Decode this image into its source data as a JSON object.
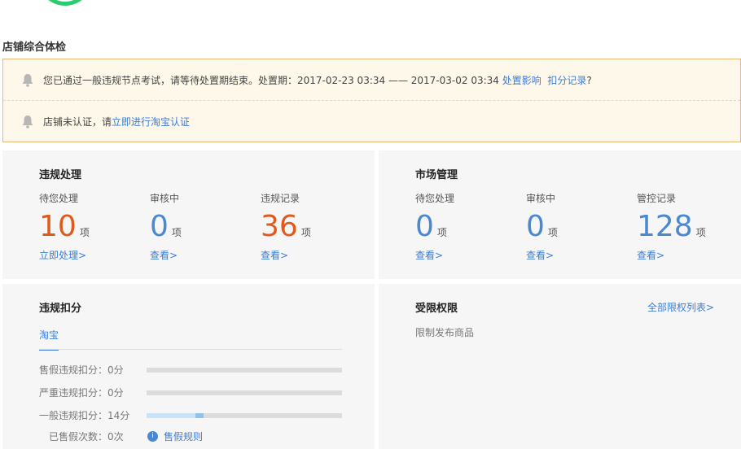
{
  "page": {
    "title": "店铺综合体检"
  },
  "colors": {
    "accent": "#3b7dd8",
    "alert_number": "#e05a1c",
    "info_number": "#4a89d0",
    "notice_bg": "#fdf8e9",
    "notice_border": "#e8b875",
    "logo_green": "#2ecc71"
  },
  "notices": [
    {
      "icon": "bell-icon",
      "text": "您已通过一般违规节点考试，请等待处置期结束。处置期：2017-02-23 03:34 —— 2017-03-02 03:34 ",
      "link1": "处置影响",
      "link2": "扣分记录",
      "suffix": "?"
    },
    {
      "icon": "bell-icon",
      "text": "店铺未认证，请",
      "link1": "立即进行淘宝认证"
    }
  ],
  "violations": {
    "title": "违规处理",
    "stats": [
      {
        "label": "待您处理",
        "value": "10",
        "unit": "项",
        "link": "立即处理>"
      },
      {
        "label": "审核中",
        "value": "0",
        "unit": "项",
        "link": "查看>"
      },
      {
        "label": "违规记录",
        "value": "36",
        "unit": "项",
        "link": "查看>"
      }
    ]
  },
  "market": {
    "title": "市场管理",
    "stats": [
      {
        "label": "待您处理",
        "value": "0",
        "unit": "项",
        "link": "查看>"
      },
      {
        "label": "审核中",
        "value": "0",
        "unit": "项",
        "link": "查看>"
      },
      {
        "label": "管控记录",
        "value": "128",
        "unit": "项",
        "link": "查看>"
      }
    ]
  },
  "deductions": {
    "title": "违规扣分",
    "tab": "淘宝",
    "rows": [
      {
        "label": "售假违规扣分：0分",
        "points": 0
      },
      {
        "label": "严重违规扣分：0分",
        "points": 0
      },
      {
        "label": "一般违规扣分：14分",
        "points": 14
      }
    ],
    "fake_count": "已售假次数：0次",
    "fake_rule": "售假规则",
    "info_icon": "info-icon"
  },
  "restrictions": {
    "title": "受限权限",
    "all_link": "全部限权列表>",
    "items": [
      "限制发布商品"
    ]
  }
}
